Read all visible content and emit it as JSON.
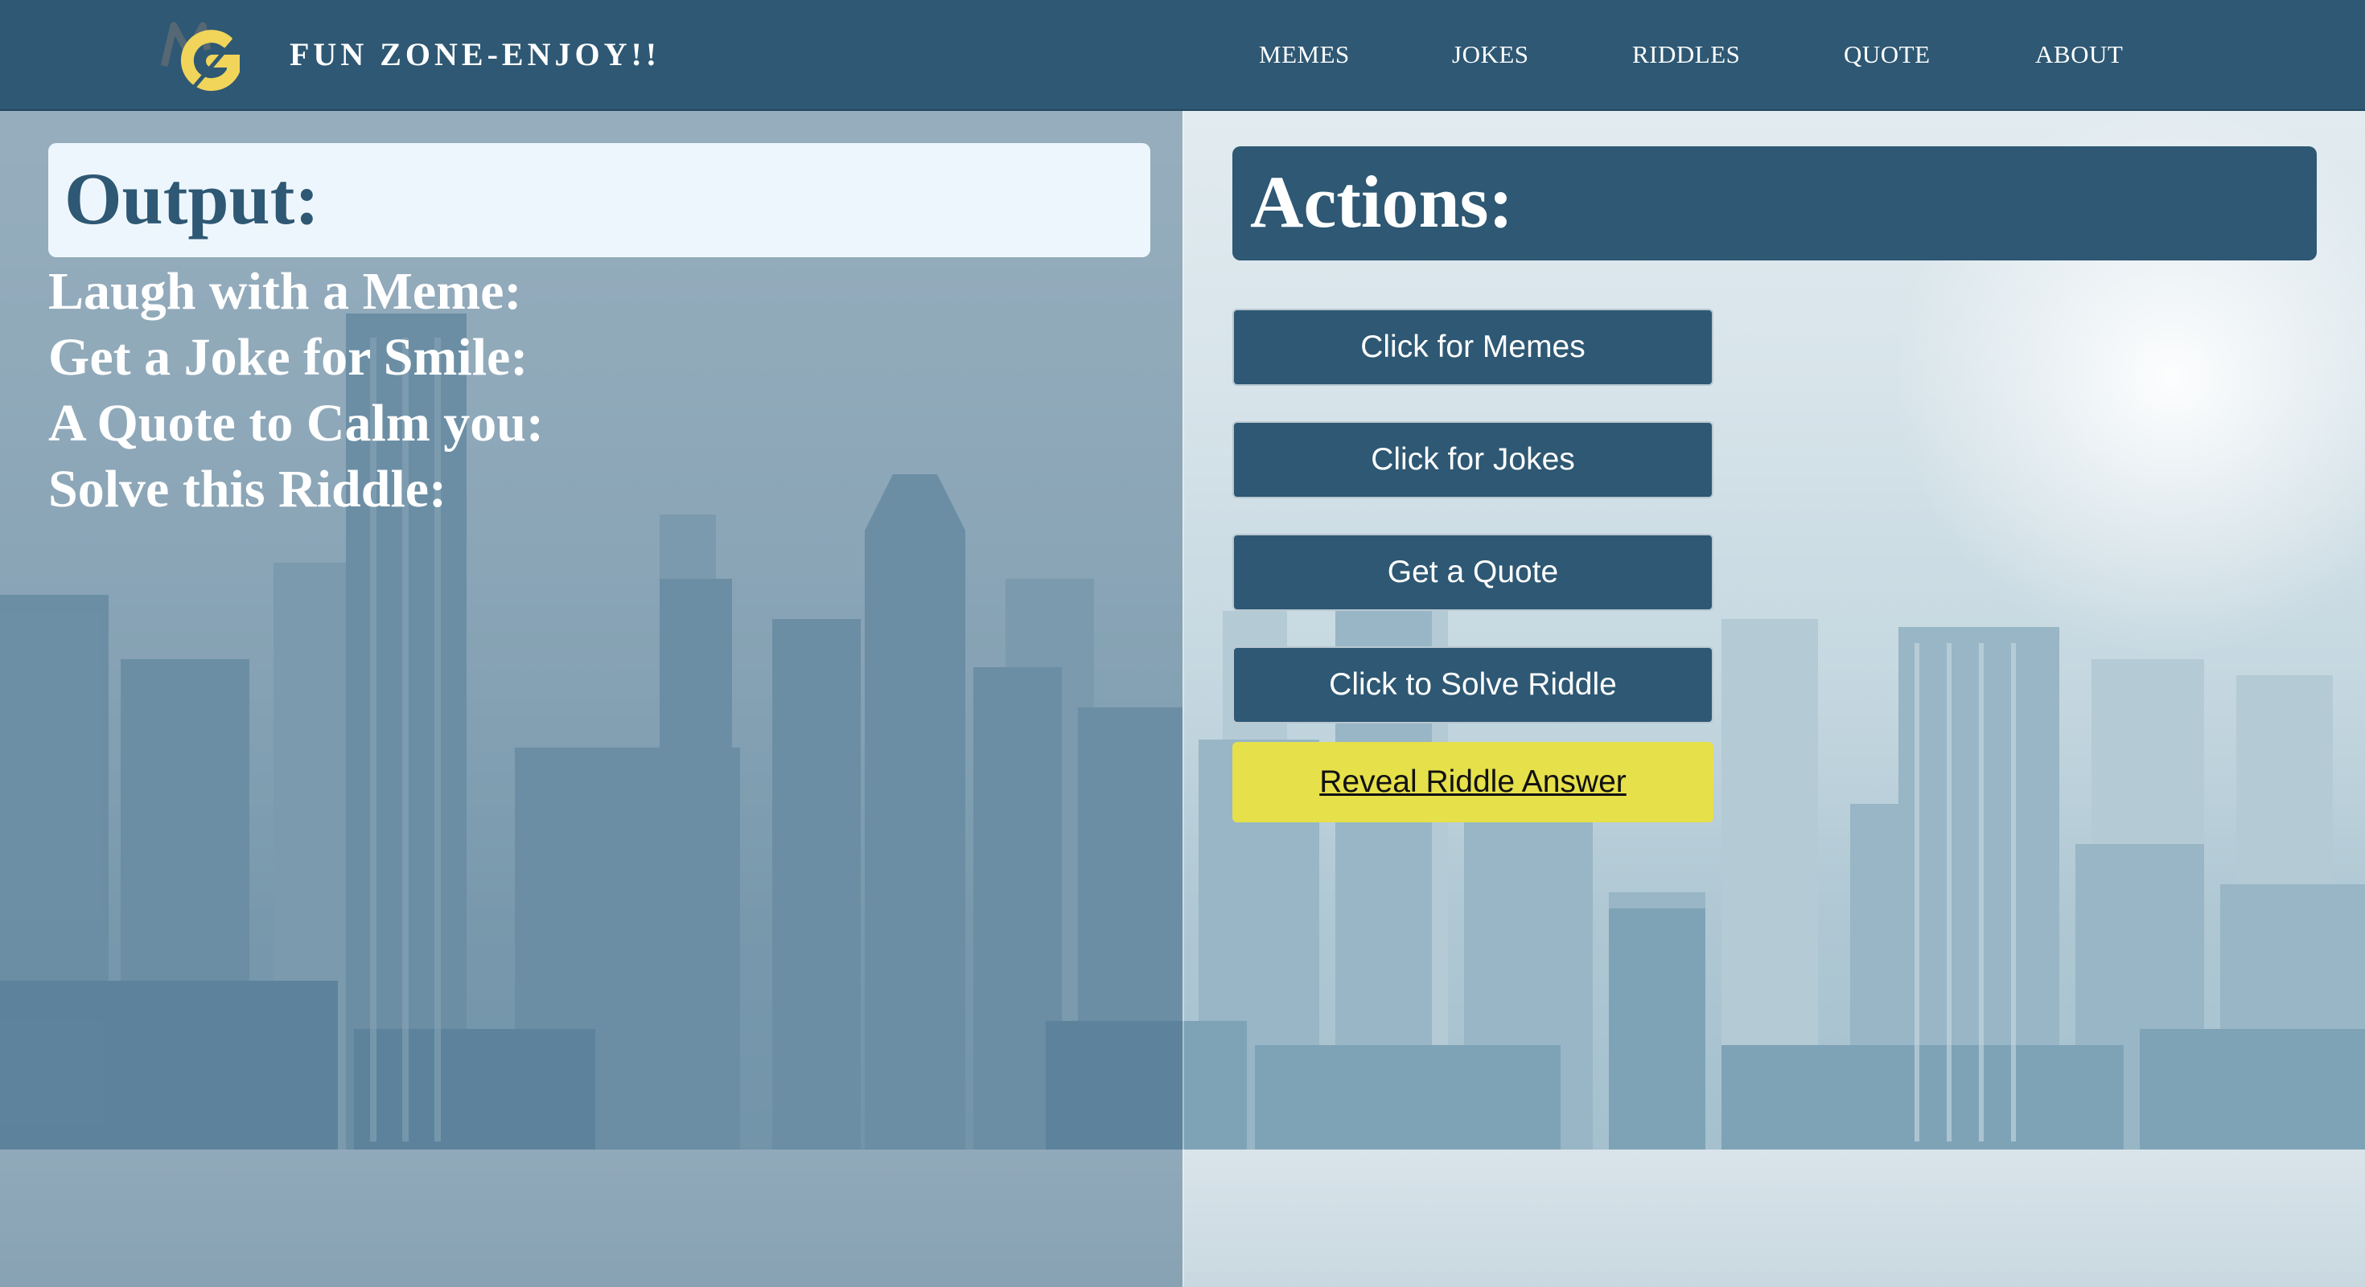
{
  "header": {
    "brand": "FUN ZONE-ENJOY!!",
    "nav": [
      {
        "label": "MEMES"
      },
      {
        "label": "JOKES"
      },
      {
        "label": "RIDDLES"
      },
      {
        "label": "QUOTE"
      },
      {
        "label": "ABOUT"
      }
    ]
  },
  "output": {
    "title": "Output:",
    "lines": [
      "Laugh with a Meme:",
      "Get a Joke for Smile:",
      "A Quote to Calm you:",
      "Solve this Riddle:"
    ]
  },
  "actions": {
    "title": "Actions:",
    "buttons": [
      {
        "label": "Click for Memes"
      },
      {
        "label": "Click for Jokes"
      },
      {
        "label": "Get a Quote"
      },
      {
        "label": "Click to Solve Riddle"
      }
    ],
    "reveal_label": "Reveal Riddle Answer"
  },
  "colors": {
    "primary": "#2e5873",
    "output_box": "#eef6fd",
    "reveal_button": "#e6e04a",
    "logo_yellow": "#f1d45a"
  },
  "icons": {
    "logo": "mg-logo-icon"
  }
}
